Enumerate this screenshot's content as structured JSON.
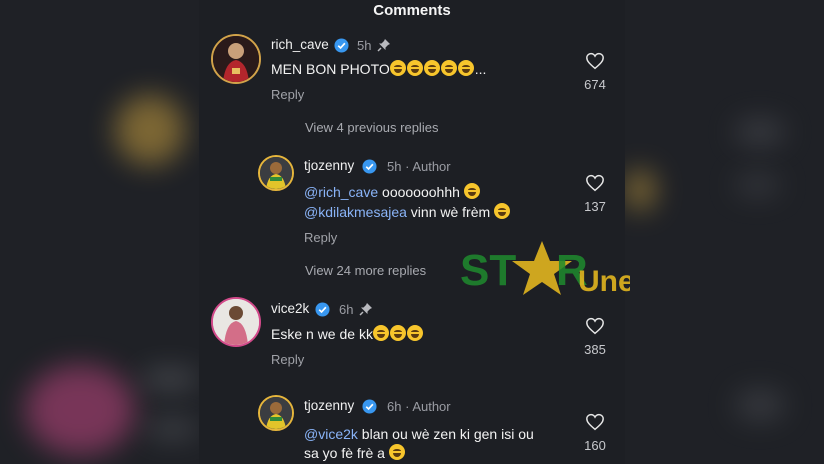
{
  "header": {
    "title": "Comments"
  },
  "comments": [
    {
      "username": "rich_cave",
      "time": "5h",
      "text": "MEN BON PHOTO",
      "suffix": "...",
      "emoji_count": 5,
      "reply": "Reply",
      "likes": "674"
    },
    {
      "username": "tjozenny",
      "time": "5h",
      "author": "Author",
      "line1_mention": "@rich_cave",
      "line1_text": " ooooooohhh ",
      "line2_mention": "@kdilakmesajea",
      "line2_text": " vinn wè frèm ",
      "reply": "Reply",
      "likes": "137"
    },
    {
      "username": "vice2k",
      "time": "6h",
      "text": "Eske n we de kk",
      "emoji_count": 3,
      "reply": "Reply",
      "likes": "385"
    },
    {
      "username": "tjozenny",
      "time": "6h",
      "author": "Author",
      "line1_mention": "@vice2k",
      "line1_text": " blan ou wè zen ki gen isi ou",
      "line2_text": "sa yo fè frè a ",
      "likes": "160"
    }
  ],
  "view_previous": "View 4 previous replies",
  "view_more": "View 24 more replies",
  "watermark": {
    "text": "STAR Une",
    "colors": {
      "green": "#1f8a2e",
      "gold": "#e2b51f"
    }
  },
  "colors": {
    "verified": "#3897f0",
    "background": "#1d1f24"
  },
  "icons": {
    "verified": "verified-badge-icon",
    "pin": "pin-icon",
    "like": "heart-icon"
  }
}
